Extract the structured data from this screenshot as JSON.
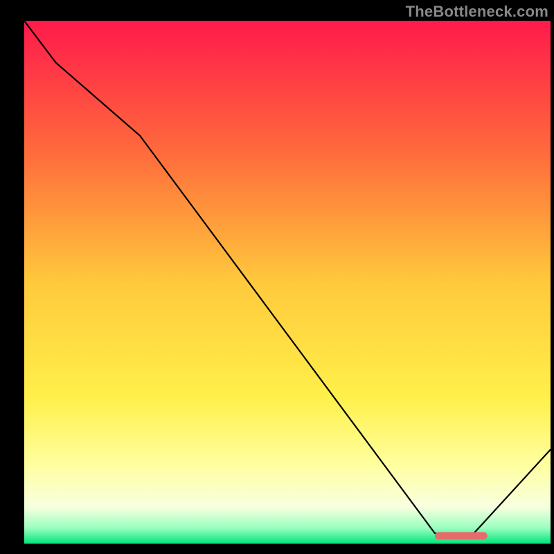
{
  "watermark": "TheBottleneck.com",
  "chart_data": {
    "type": "line",
    "title": "",
    "xlabel": "",
    "ylabel": "",
    "xlim": [
      0,
      100
    ],
    "ylim": [
      0,
      100
    ],
    "grid": false,
    "legend": false,
    "background_gradient": {
      "stops": [
        {
          "pct": 0,
          "color": "#ff1a4b"
        },
        {
          "pct": 25,
          "color": "#ff6a3c"
        },
        {
          "pct": 50,
          "color": "#ffc93c"
        },
        {
          "pct": 72,
          "color": "#fff04a"
        },
        {
          "pct": 85,
          "color": "#ffffa0"
        },
        {
          "pct": 93,
          "color": "#f8ffe0"
        },
        {
          "pct": 97,
          "color": "#9affc0"
        },
        {
          "pct": 100,
          "color": "#00e47a"
        }
      ]
    },
    "series": [
      {
        "name": "bottleneck-curve",
        "color": "#000000",
        "x": [
          0,
          6,
          22,
          78,
          85,
          100
        ],
        "y": [
          100,
          92,
          78,
          2,
          1.5,
          18
        ]
      }
    ],
    "marker": {
      "name": "optimal-range",
      "color": "#e86a6a",
      "x_start": 78,
      "x_end": 88,
      "y": 1.5,
      "thickness_pct": 1.4
    }
  }
}
